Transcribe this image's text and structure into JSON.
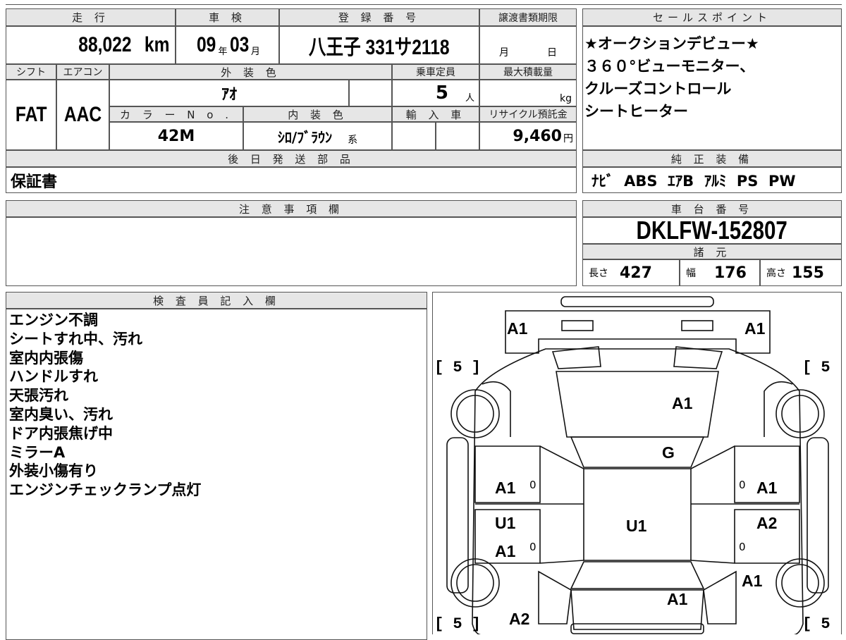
{
  "labels": {
    "mileage": "走 行",
    "inspection": "車 検",
    "registration": "登 録 番 号",
    "transfer_deadline": "譲渡書類期限",
    "sales_point": "セールスポイント",
    "shift": "シフト",
    "aircon": "エアコン",
    "exterior_color": "外 装 色",
    "capacity": "乗車定員",
    "max_load": "最大積載量",
    "color_no": "カ ラ ー N o .",
    "interior_color": "内 装 色",
    "import": "輸 入 車",
    "recycle": "リサイクル預託金",
    "later_parts": "後 日 発 送 部 品",
    "genuine_equip": "純 正 装 備",
    "caution": "注 意 事 項 欄",
    "chassis_no": "車 台 番 号",
    "specs": "諸 元",
    "inspector_notes": "検 査 員 記 入 欄"
  },
  "vehicle": {
    "mileage_value": "88,022",
    "mileage_unit": "km",
    "inspection_year": "09",
    "year_unit": "年",
    "inspection_month": "03",
    "month_unit": "月",
    "registration_number": "八王子 331サ2118",
    "transfer_month_unit": "月",
    "transfer_day_unit": "日",
    "shift_value": "FAT",
    "aircon_value": "AAC",
    "exterior_color_value": "ｱｵ",
    "capacity_value": "5",
    "capacity_unit": "人",
    "max_load_unit": "kg",
    "color_no_value": "42M",
    "interior_color_value": "ｼﾛ/ﾌﾞﾗｳﾝ",
    "interior_suffix": "系",
    "recycle_value": "9,460",
    "recycle_unit": "円",
    "later_parts_value": "保証書",
    "genuine_equip_value": "ﾅﾋﾞ  ABS  ｴｱB  ｱﾙﾐ  PS  PW",
    "chassis_no_value": "DKLFW-152807",
    "length_label": "長さ",
    "length_value": "427",
    "width_label": "幅",
    "width_value": "176",
    "height_label": "高さ",
    "height_value": "155"
  },
  "sales_points": [
    "★オークションデビュー★",
    "３６０°ビューモニター、",
    "クルーズコントロール",
    "シートヒーター"
  ],
  "inspector_notes": [
    "エンジン不調",
    "シートすれ中、汚れ",
    "室内内張傷",
    "ハンドルすれ",
    "天張汚れ",
    "室内臭い、汚れ",
    "ドア内張焦げ中",
    "ミラーA",
    "外装小傷有り",
    "エンジンチェックランプ点灯"
  ],
  "diagram": {
    "tire_fl": "[ 5 ]",
    "tire_fr": "[ 5 ]",
    "tire_rl": "[ 5 ]",
    "tire_rr": "[ 5 ]",
    "front_left_corner": "A1",
    "front_right_corner": "A1",
    "hood": "A1",
    "windshield": "G",
    "front_left_door": "A1",
    "front_right_door": "A1",
    "roof": "U1",
    "rear_left_door_top": "U1",
    "rear_left_door_bottom": "A1",
    "rear_right_door": "A2",
    "rear_right_quarter": "A1",
    "trunk": "A1",
    "rear_left_quarter": "A2",
    "zero_1": "0",
    "zero_2": "0",
    "zero_3": "0",
    "zero_4": "0"
  }
}
